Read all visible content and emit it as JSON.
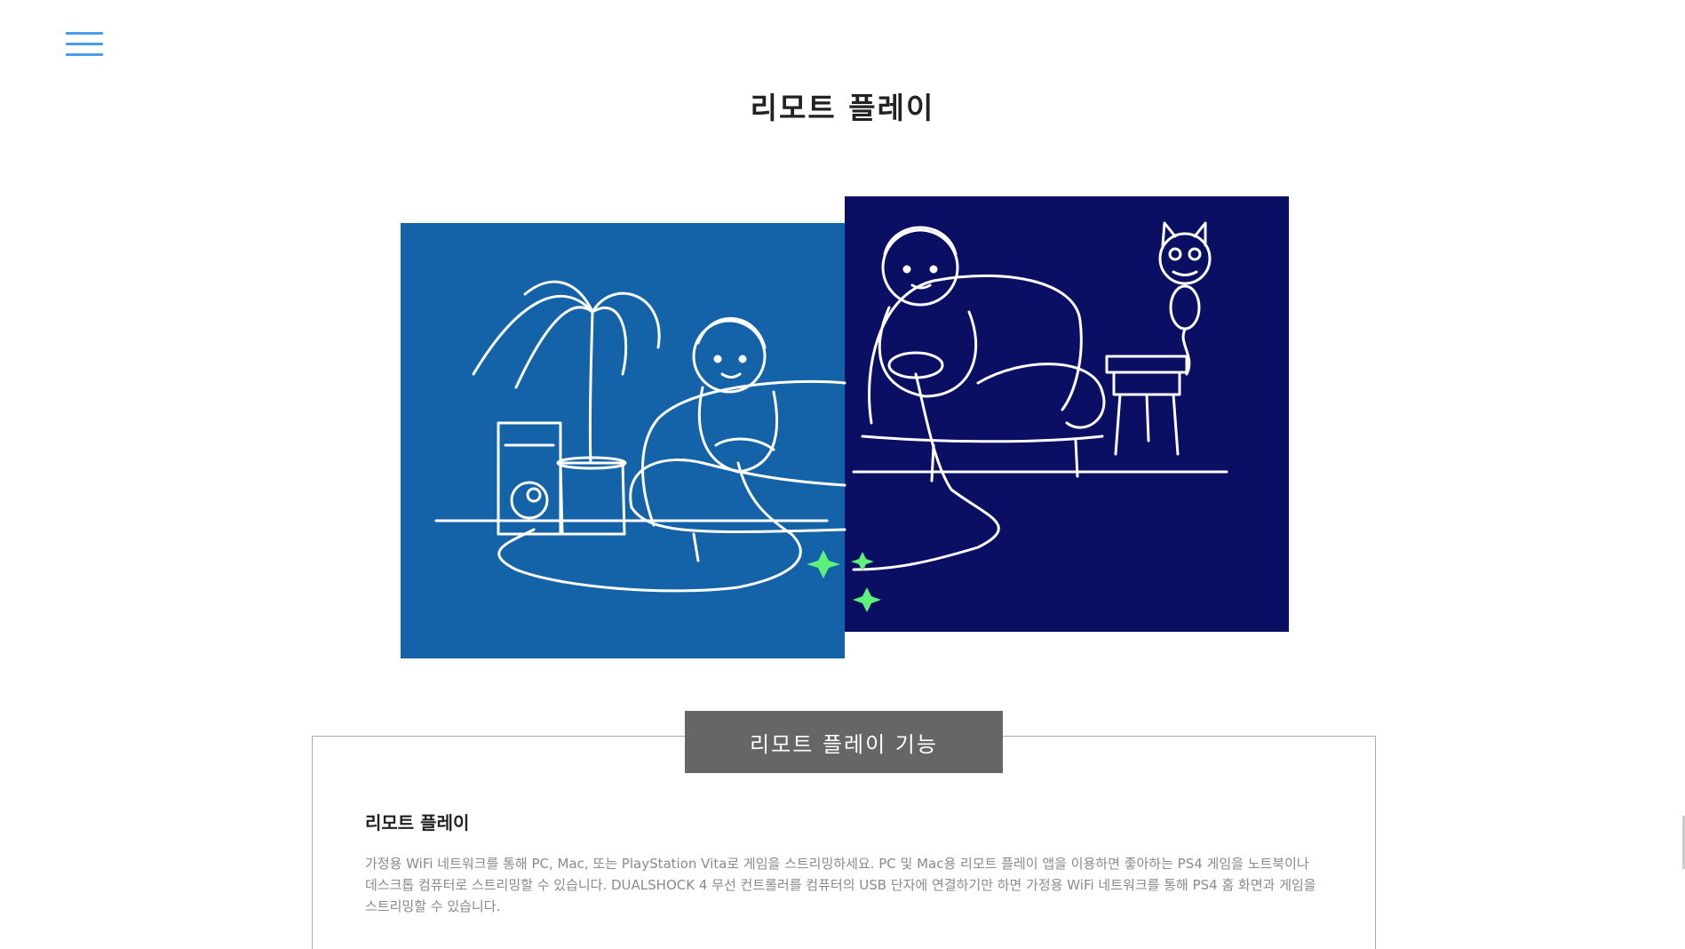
{
  "header": {
    "menu_icon": "hamburger-menu-icon",
    "accent": "#4a9be8"
  },
  "page": {
    "title": "리모트 플레이"
  },
  "hero": {
    "left_panel_color": "#1462a8",
    "right_panel_color": "#0a0f64",
    "sparkle_color": "#5ef07a"
  },
  "features": {
    "tab_label": "리모트 플레이 기능",
    "items": [
      {
        "title": "리모트 플레이",
        "description": "가정용 WiFi 네트워크를 통해 PC, Mac, 또는 PlayStation Vita로 게임을 스트리밍하세요. PC 및 Mac용 리모트 플레이 앱을 이용하면 좋아하는 PS4 게임을 노트북이나 데스크톱 컴퓨터로 스트리밍할 수 있습니다. DUALSHOCK 4 무선 컨트롤러를 컴퓨터의 USB 단자에 연결하기만 하면 가정용 WiFi 네트워크를 통해 PS4 홈 화면과 게임을 스트리밍할 수 있습니다."
      }
    ]
  }
}
